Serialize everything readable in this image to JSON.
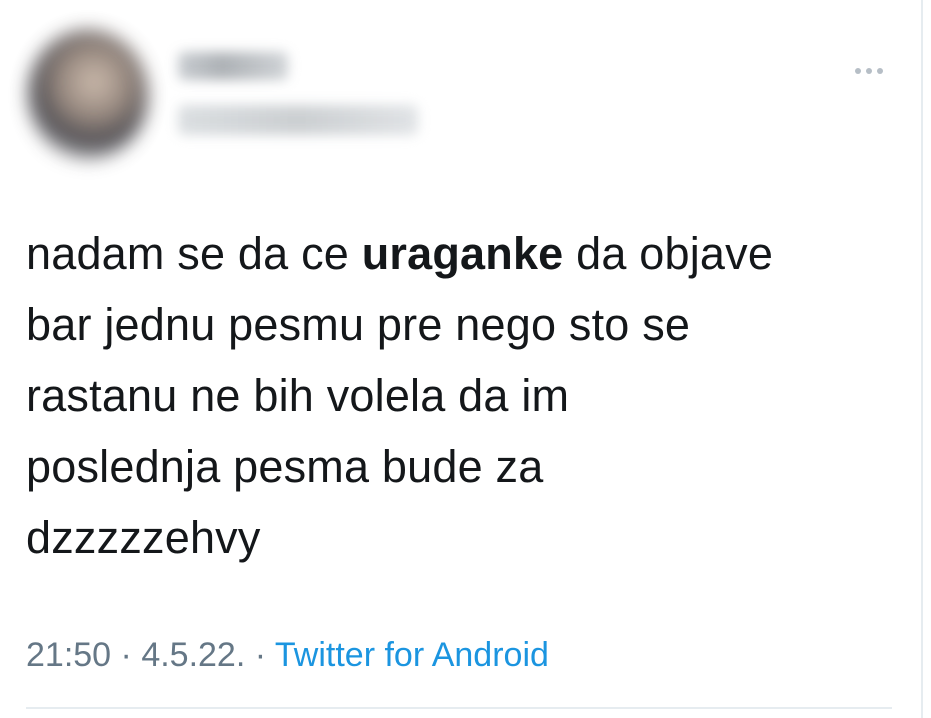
{
  "tweet": {
    "author_name": "",
    "author_handle": "",
    "text": {
      "line1_pre": "nadam se da ce ",
      "line1_bold": "uraganke",
      "line1_post": " da objave",
      "line2": "bar jednu pesmu pre nego sto se",
      "line3": "rastanu ne bih volela da im",
      "line4": "poslednja pesma bude za",
      "line5": "dzzzzzehvy"
    },
    "time": "21:50",
    "separator": " · ",
    "date": "4.5.22.",
    "source": "Twitter for Android",
    "more_icon": "more-horizontal-icon"
  },
  "colors": {
    "text": "#14171a",
    "meta": "#657786",
    "link": "#1b95e0",
    "divider": "#e6ecf0",
    "icon": "#b6bec6"
  }
}
